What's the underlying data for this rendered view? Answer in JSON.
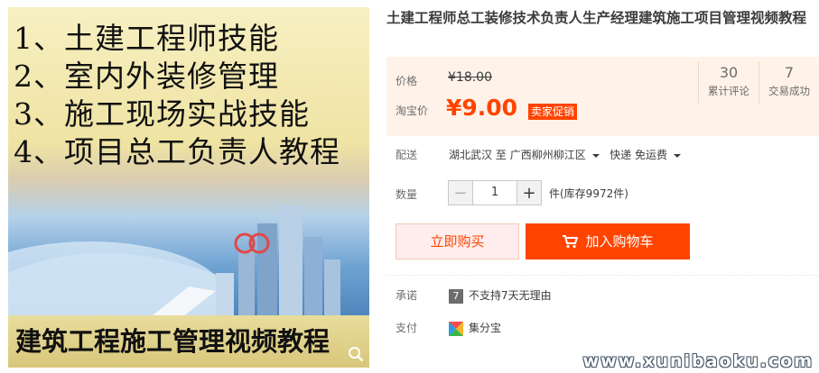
{
  "image": {
    "lines": [
      "1、土建工程师技能",
      "2、室内外装修管理",
      "3、施工现场实战技能",
      "4、项目总工负责人教程"
    ],
    "bottom_title": "建筑工程施工管理视频教程"
  },
  "product": {
    "title": "土建工程师总工装修技术负责人生产经理建筑施工项目管理视频教程"
  },
  "price": {
    "label": "价格",
    "original": "¥18.00",
    "promo_label": "淘宝价",
    "promo": "¥9.00",
    "promo_tag": "卖家促销"
  },
  "stats": [
    {
      "value": "30",
      "caption": "累计评论"
    },
    {
      "value": "7",
      "caption": "交易成功"
    }
  ],
  "shipping": {
    "label": "配送",
    "from": "湖北武汉",
    "to_word": "至",
    "to": "广西柳州柳江区",
    "method": "快递 免运费"
  },
  "quantity": {
    "label": "数量",
    "value": "1",
    "stock": "件(库存9972件)"
  },
  "actions": {
    "buy_now": "立即购买",
    "add_cart": "加入购物车"
  },
  "promise": {
    "label": "承诺",
    "badge": "7",
    "text": "不支持7天无理由"
  },
  "payment": {
    "label": "支付",
    "method": "集分宝"
  },
  "watermark": "www.xunibaoku.com",
  "colors": {
    "accent": "#ff4400",
    "price_bg": "#fff2e8"
  }
}
